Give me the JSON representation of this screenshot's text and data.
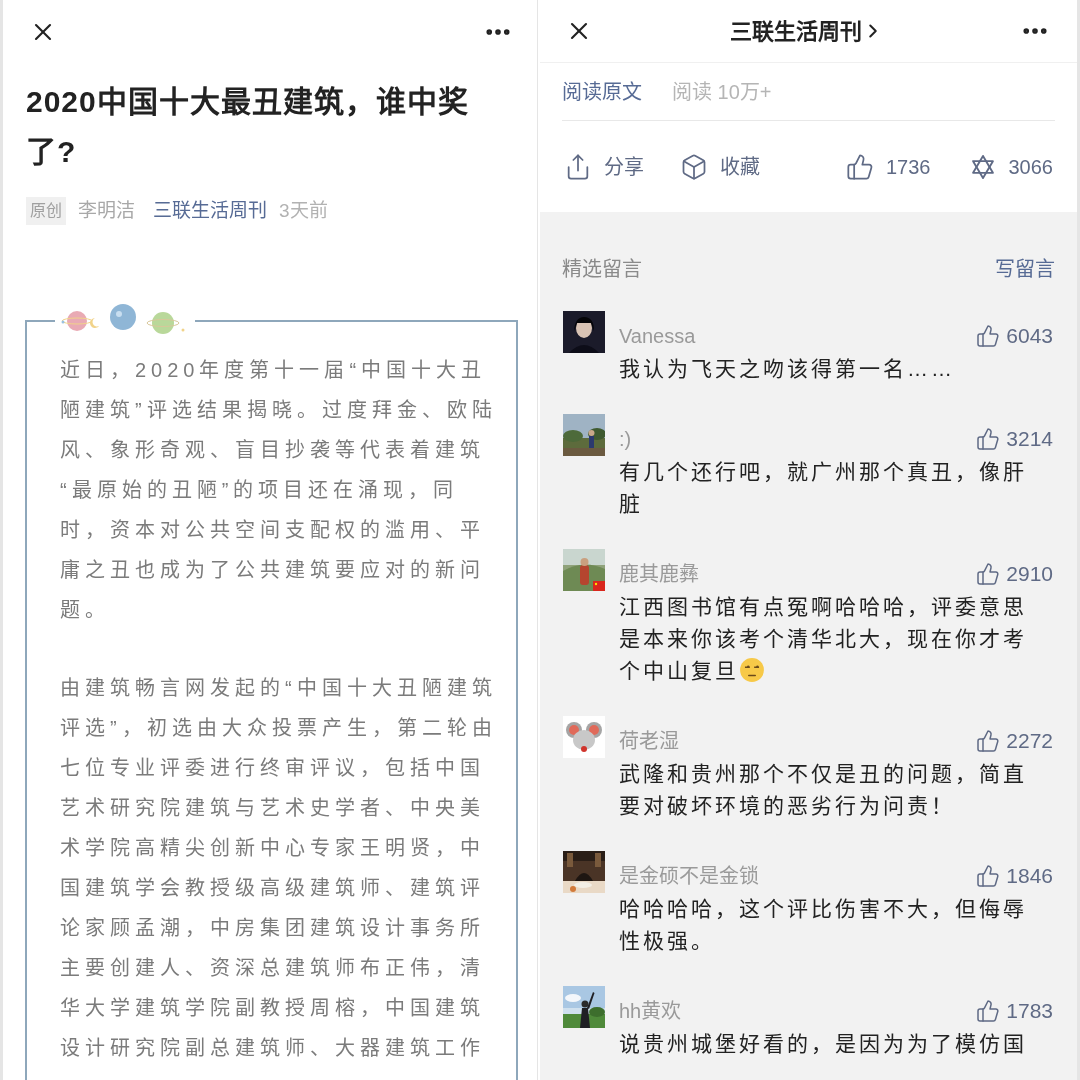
{
  "left": {
    "title": "2020中国十大最丑建筑，谁中奖了?",
    "badge": "原创",
    "author": "李明洁",
    "account": "三联生活周刊",
    "time": "3天前",
    "paragraphs": [
      "近日，2020年度第十一届“中国十大丑陋建筑”评选结果揭晓。过度拜金、欧陆风、象形奇观、盲目抄袭等代表着建筑“最原始的丑陋”的项目还在涌现，同时，资本对公共空间支配权的滥用、平庸之丑也成为了公共建筑要应对的新问题。",
      "由建筑畅言网发起的“中国十大丑陋建筑评选”，初选由大众投票产生，第二轮由七位专业评委进行终审评议，包括中国艺术研究院建筑与艺术史学者、中央美术学院高精尖创新中心专家王明贤，中国建筑学会教授级高级建筑师、建筑评论家顾孟潮，中房集团建筑设计事务所主要创建人、资深总建筑师布正伟，清华大学建筑学院副教授周榕，中国建筑设计研究院副总建筑师、大器建筑工作"
    ]
  },
  "right": {
    "header_title": "三联生活周刊",
    "read_original": "阅读原文",
    "reads": "阅读 10万+",
    "actions": [
      {
        "kind": "share",
        "label": "分享"
      },
      {
        "kind": "favorite",
        "label": "收藏"
      },
      {
        "kind": "like",
        "label": "1736"
      },
      {
        "kind": "wow",
        "label": "3066"
      }
    ],
    "comments_heading": "精选留言",
    "write_comment": "写留言",
    "comments": [
      {
        "name": "Vanessa",
        "likes": "6043",
        "text": "我认为飞天之吻该得第一名……"
      },
      {
        "name": ":)",
        "likes": "3214",
        "text": "有几个还行吧，就广州那个真丑，像肝脏"
      },
      {
        "name": "鹿其鹿彝",
        "likes": "2910",
        "text": "江西图书馆有点冤啊哈哈哈，评委意思是本来你该考个清华北大，现在你才考个中山复旦",
        "emoji": true
      },
      {
        "name": "荷老湿",
        "likes": "2272",
        "text": "武隆和贵州那个不仅是丑的问题，简直要对破坏环境的恶劣行为问责！"
      },
      {
        "name": "是金硕不是金锁",
        "likes": "1846",
        "text": "哈哈哈哈，这个评比伤害不大，但侮辱性极强。"
      },
      {
        "name": "hh黄欢",
        "likes": "1783",
        "text": "说贵州城堡好看的，是因为为了模仿国"
      }
    ]
  }
}
